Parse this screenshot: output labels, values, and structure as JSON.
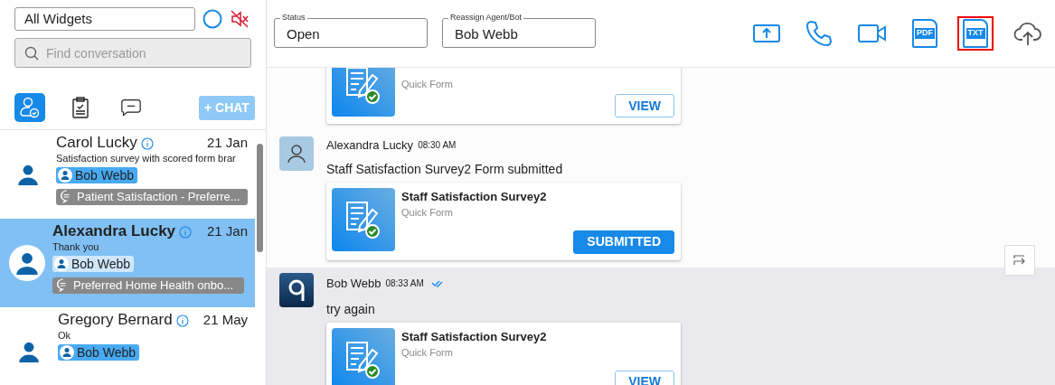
{
  "sidebar": {
    "widget_select": {
      "value": "All Widgets"
    },
    "search": {
      "placeholder": "Find conversation"
    },
    "tabs": [
      {
        "selected": true
      },
      {
        "selected": false
      },
      {
        "selected": false
      }
    ],
    "new_chat": {
      "label": "+ CHAT",
      "disabled": true
    },
    "conversations": [
      {
        "name": "Carol Lucky",
        "date": "21 Jan",
        "preview": "Satisfaction survey with scored form brar",
        "agent": "Bob Webb",
        "widget": "Patient Satisfaction - Preferre...",
        "selected": false
      },
      {
        "name": "Alexandra Lucky",
        "date": "21 Jan",
        "preview": "Thank you",
        "agent": "Bob Webb",
        "widget": "Preferred Home Health onbo...",
        "selected": true
      },
      {
        "name": "Gregory Bernard",
        "date": "21 May",
        "preview": "Ok",
        "agent": "Bob Webb",
        "selected": false
      }
    ]
  },
  "header": {
    "status": {
      "label": "Status",
      "value": "Open"
    },
    "reassign": {
      "label": "Reassign Agent/Bot",
      "value": "Bob Webb"
    },
    "tools": [
      {
        "kind": "share",
        "selected": false
      },
      {
        "kind": "phone",
        "selected": false
      },
      {
        "kind": "video",
        "selected": false
      },
      {
        "kind": "pdf",
        "text": "PDF",
        "selected": false
      },
      {
        "kind": "txt",
        "text": "TXT",
        "selected": true
      },
      {
        "kind": "upload",
        "selected": false
      }
    ]
  },
  "messages": [
    {
      "kind": "form",
      "highlighted": false,
      "form": {
        "subtitle": "Quick Form",
        "action": "VIEW",
        "submitted": false
      }
    },
    {
      "kind": "customer_message",
      "highlighted": false,
      "sender": "Alexandra Lucky",
      "time": "08:30 AM",
      "read": false,
      "text": "Staff Satisfaction Survey2 Form submitted",
      "form": {
        "title": "Staff Satisfaction Survey2",
        "subtitle": "Quick Form",
        "action": "SUBMITTED",
        "submitted": true
      }
    },
    {
      "kind": "agent_message",
      "highlighted": true,
      "sender": "Bob Webb",
      "time": "08:33 AM",
      "read": true,
      "text": "try again",
      "form": {
        "title": "Staff Satisfaction Survey2",
        "subtitle": "Quick Form",
        "action": "VIEW",
        "submitted": false
      }
    }
  ]
}
